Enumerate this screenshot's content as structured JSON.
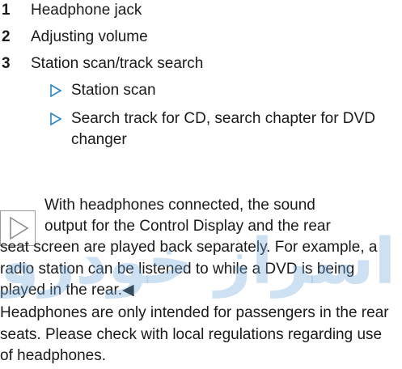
{
  "items": [
    {
      "num": "1",
      "label": "Headphone jack"
    },
    {
      "num": "2",
      "label": "Adjusting volume"
    },
    {
      "num": "3",
      "label": "Station scan/track search"
    }
  ],
  "subitems": [
    {
      "label": "Station scan"
    },
    {
      "label": "Search track for CD, search chapter for DVD changer"
    }
  ],
  "note": {
    "line1": "With headphones connected, the sound",
    "line2": "output for the Control Display and the rear",
    "rest": "seat screen are played back separately. For example, a radio station can be listened to while a DVD is being played in the rear.◀"
  },
  "paragraph": "Headphones are only intended for passengers in the rear seats. Please check with local regulations regarding use of headphones.",
  "watermark_text": "اسراز خودرو",
  "colors": {
    "accent": "#2b86c8",
    "text": "#1a1a1a",
    "watermark": "#6fa8dc"
  }
}
